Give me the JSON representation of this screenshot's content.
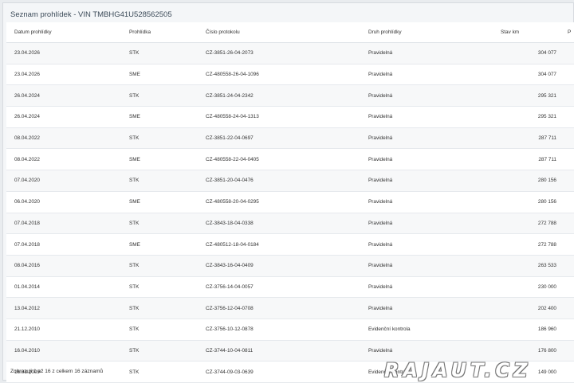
{
  "panel": {
    "title": "Seznam prohlídek - VIN TMBHG41U528562505"
  },
  "table": {
    "columns": [
      "Datum prohlídky",
      "Prohlídka",
      "Číslo protokolu",
      "Druh prohlídky",
      "Stav km",
      "P"
    ],
    "rows": [
      [
        "23.04.2026",
        "STK",
        "CZ-3851-26-04-2073",
        "Pravidelná",
        "304 077"
      ],
      [
        "23.04.2026",
        "SME",
        "CZ-480558-26-04-1096",
        "Pravidelná",
        "304 077"
      ],
      [
        "26.04.2024",
        "STK",
        "CZ-3851-24-04-2342",
        "Pravidelná",
        "295 321"
      ],
      [
        "26.04.2024",
        "SME",
        "CZ-480558-24-04-1313",
        "Pravidelná",
        "295 321"
      ],
      [
        "08.04.2022",
        "STK",
        "CZ-3851-22-04-0697",
        "Pravidelná",
        "287 711"
      ],
      [
        "08.04.2022",
        "SME",
        "CZ-480558-22-04-0405",
        "Pravidelná",
        "287 711"
      ],
      [
        "07.04.2020",
        "STK",
        "CZ-3851-20-04-0476",
        "Pravidelná",
        "280 156"
      ],
      [
        "06.04.2020",
        "SME",
        "CZ-480558-20-04-0295",
        "Pravidelná",
        "280 156"
      ],
      [
        "07.04.2018",
        "STK",
        "CZ-3843-18-04-0338",
        "Pravidelná",
        "272 788"
      ],
      [
        "07.04.2018",
        "SME",
        "CZ-480512-18-04-0184",
        "Pravidelná",
        "272 788"
      ],
      [
        "08.04.2016",
        "STK",
        "CZ-3843-16-04-0409",
        "Pravidelná",
        "263 533"
      ],
      [
        "01.04.2014",
        "STK",
        "CZ-3756-14-04-0057",
        "Pravidelná",
        "230 000"
      ],
      [
        "13.04.2012",
        "STK",
        "CZ-3756-12-04-0708",
        "Pravidelná",
        "202 400"
      ],
      [
        "21.12.2010",
        "STK",
        "CZ-3756-10-12-0878",
        "Evidenční kontrola",
        "186 960"
      ],
      [
        "16.04.2010",
        "STK",
        "CZ-3744-10-04-0811",
        "Pravidelná",
        "176 800"
      ],
      [
        "16.03.2009",
        "STK",
        "CZ-3744-09-03-0639",
        "Evidenční kontrola",
        "149 000"
      ]
    ]
  },
  "footer": {
    "summary": "Zobrazuji 1 až 16 z celkem 16 záznamů"
  },
  "watermark": {
    "text": "RAJAUT.CZ"
  }
}
